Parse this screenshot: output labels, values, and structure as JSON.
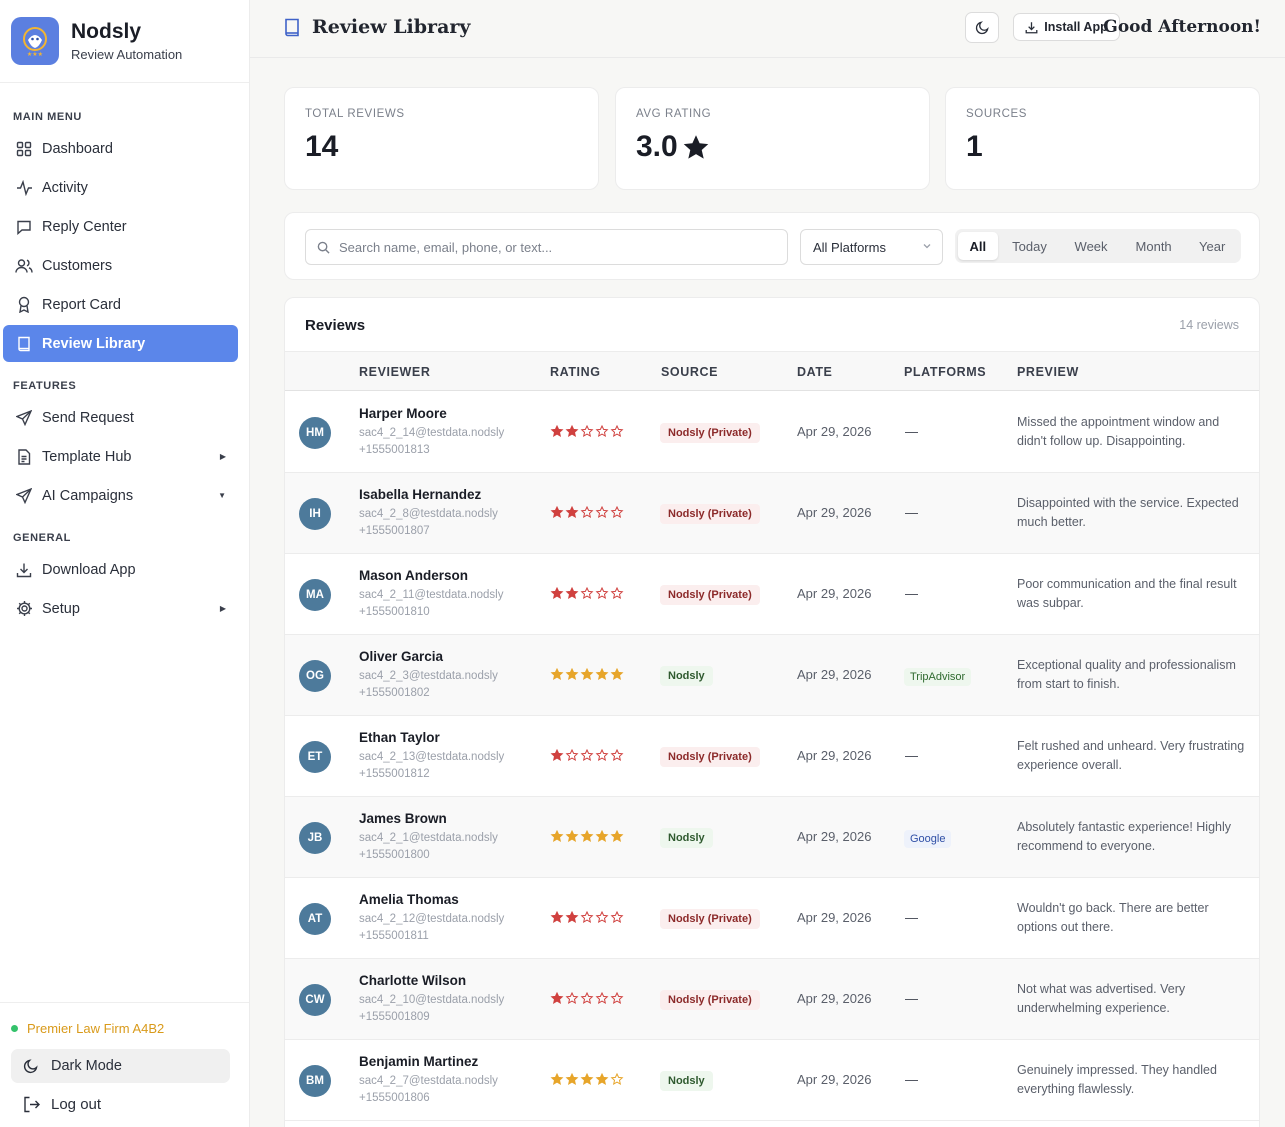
{
  "brand": {
    "name": "Nodsly",
    "subtitle": "Review Automation"
  },
  "sidebar": {
    "sections": {
      "main": "MAIN MENU",
      "features": "FEATURES",
      "general": "GENERAL"
    },
    "items": [
      {
        "label": "Dashboard",
        "icon": "grid-icon"
      },
      {
        "label": "Activity",
        "icon": "activity-icon"
      },
      {
        "label": "Reply Center",
        "icon": "message-icon"
      },
      {
        "label": "Customers",
        "icon": "users-icon"
      },
      {
        "label": "Report Card",
        "icon": "award-icon"
      },
      {
        "label": "Review Library",
        "icon": "book-icon",
        "active": true
      },
      {
        "label": "Send Request",
        "icon": "send-icon"
      },
      {
        "label": "Template Hub",
        "icon": "file-icon"
      },
      {
        "label": "AI Campaigns",
        "icon": "send-icon"
      },
      {
        "label": "Download App",
        "icon": "download-icon"
      },
      {
        "label": "Setup",
        "icon": "gear-icon"
      }
    ],
    "firm": "Premier Law Firm A4B2",
    "dark_mode": "Dark Mode",
    "logout": "Log out"
  },
  "header": {
    "title": "Review Library",
    "install": "Install App",
    "greeting": "Good Afternoon!"
  },
  "stats": [
    {
      "label": "TOTAL REVIEWS",
      "value": "14"
    },
    {
      "label": "AVG RATING",
      "value": "3.0"
    },
    {
      "label": "SOURCES",
      "value": "1"
    }
  ],
  "filters": {
    "search_placeholder": "Search name, email, phone, or text...",
    "platform": "All Platforms",
    "ranges": [
      "All",
      "Today",
      "Week",
      "Month",
      "Year"
    ],
    "active_range": "All"
  },
  "table": {
    "title": "Reviews",
    "count": "14 reviews",
    "columns": [
      "REVIEWER",
      "RATING",
      "SOURCE",
      "DATE",
      "PLATFORMS",
      "PREVIEW"
    ],
    "rows": [
      {
        "initials": "HM",
        "name": "Harper Moore",
        "email": "sac4_2_14@testdata.nodsly",
        "phone": "+1555001813",
        "rating": 2,
        "source": "Nodsly (Private)",
        "date": "Apr 29, 2026",
        "platform": "—",
        "preview": "Missed the appointment window and didn't follow up. Disappointing."
      },
      {
        "initials": "IH",
        "name": "Isabella Hernandez",
        "email": "sac4_2_8@testdata.nodsly",
        "phone": "+1555001807",
        "rating": 2,
        "source": "Nodsly (Private)",
        "date": "Apr 29, 2026",
        "platform": "—",
        "preview": "Disappointed with the service. Expected much better."
      },
      {
        "initials": "MA",
        "name": "Mason Anderson",
        "email": "sac4_2_11@testdata.nodsly",
        "phone": "+1555001810",
        "rating": 2,
        "source": "Nodsly (Private)",
        "date": "Apr 29, 2026",
        "platform": "—",
        "preview": "Poor communication and the final result was subpar."
      },
      {
        "initials": "OG",
        "name": "Oliver Garcia",
        "email": "sac4_2_3@testdata.nodsly",
        "phone": "+1555001802",
        "rating": 5,
        "source": "Nodsly",
        "date": "Apr 29, 2026",
        "platform": "TripAdvisor",
        "preview": "Exceptional quality and professionalism from start to finish."
      },
      {
        "initials": "ET",
        "name": "Ethan Taylor",
        "email": "sac4_2_13@testdata.nodsly",
        "phone": "+1555001812",
        "rating": 1,
        "source": "Nodsly (Private)",
        "date": "Apr 29, 2026",
        "platform": "—",
        "preview": "Felt rushed and unheard. Very frustrating experience overall."
      },
      {
        "initials": "JB",
        "name": "James Brown",
        "email": "sac4_2_1@testdata.nodsly",
        "phone": "+1555001800",
        "rating": 5,
        "source": "Nodsly",
        "date": "Apr 29, 2026",
        "platform": "Google",
        "preview": "Absolutely fantastic experience! Highly recommend to everyone."
      },
      {
        "initials": "AT",
        "name": "Amelia Thomas",
        "email": "sac4_2_12@testdata.nodsly",
        "phone": "+1555001811",
        "rating": 2,
        "source": "Nodsly (Private)",
        "date": "Apr 29, 2026",
        "platform": "—",
        "preview": "Wouldn't go back. There are better options out there."
      },
      {
        "initials": "CW",
        "name": "Charlotte Wilson",
        "email": "sac4_2_10@testdata.nodsly",
        "phone": "+1555001809",
        "rating": 1,
        "source": "Nodsly (Private)",
        "date": "Apr 29, 2026",
        "platform": "—",
        "preview": "Not what was advertised. Very underwhelming experience."
      },
      {
        "initials": "BM",
        "name": "Benjamin Martinez",
        "email": "sac4_2_7@testdata.nodsly",
        "phone": "+1555001806",
        "rating": 4,
        "source": "Nodsly",
        "date": "Apr 29, 2026",
        "platform": "—",
        "preview": "Genuinely impressed. They handled everything flawlessly."
      }
    ]
  },
  "colors": {
    "accent": "#5b86ea",
    "star_low": "#d0413f",
    "star_high": "#e7a52a",
    "avatar": "#4d7a9b"
  }
}
